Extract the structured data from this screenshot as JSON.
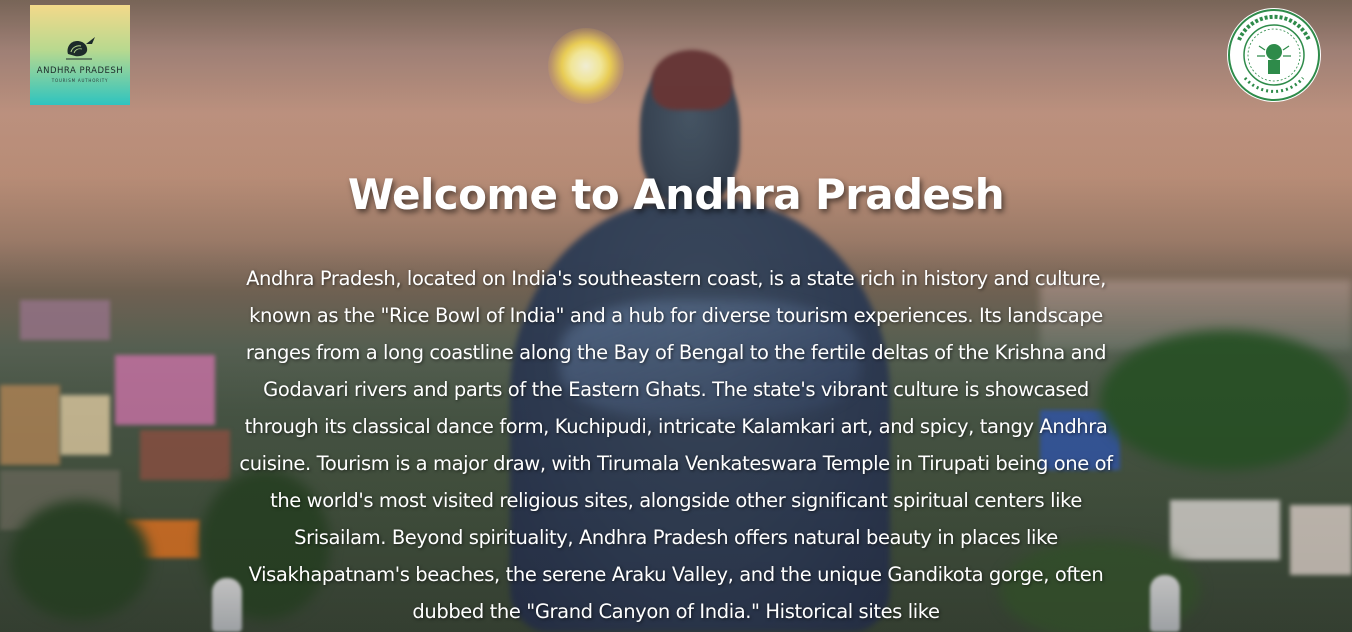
{
  "header": {
    "logo": {
      "icon": "conch-shell-icon",
      "title": "ANDHRA PRADESH",
      "subtitle": "TOURISM AUTHORITY"
    },
    "emblem": {
      "icon": "government-emblem-icon"
    }
  },
  "hero": {
    "title": "Welcome to Andhra Pradesh",
    "description": "Andhra Pradesh, located on India's southeastern coast, is a state rich in history and culture, known as the \"Rice Bowl of India\" and a hub for diverse tourism experiences. Its landscape ranges from a long coastline along the Bay of Bengal to the fertile deltas of the Krishna and Godavari rivers and parts of the Eastern Ghats. The state's vibrant culture is showcased through its classical dance form, Kuchipudi, intricate Kalamkari art, and spicy, tangy Andhra cuisine. Tourism is a major draw, with Tirumala Venkateswara Temple in Tirupati being one of the world's most visited religious sites, alongside other significant spiritual centers like Srisailam. Beyond spirituality, Andhra Pradesh offers natural beauty in places like Visakhapatnam's beaches, the serene Araku Valley, and the unique Gandikota gorge, often dubbed the \"Grand Canyon of India.\" Historical sites like"
  },
  "colors": {
    "text": "#ffffff",
    "logo_gradient_top": "#f3d98a",
    "logo_gradient_bottom": "#2ec4bf",
    "emblem_green": "#2e8b4a"
  }
}
